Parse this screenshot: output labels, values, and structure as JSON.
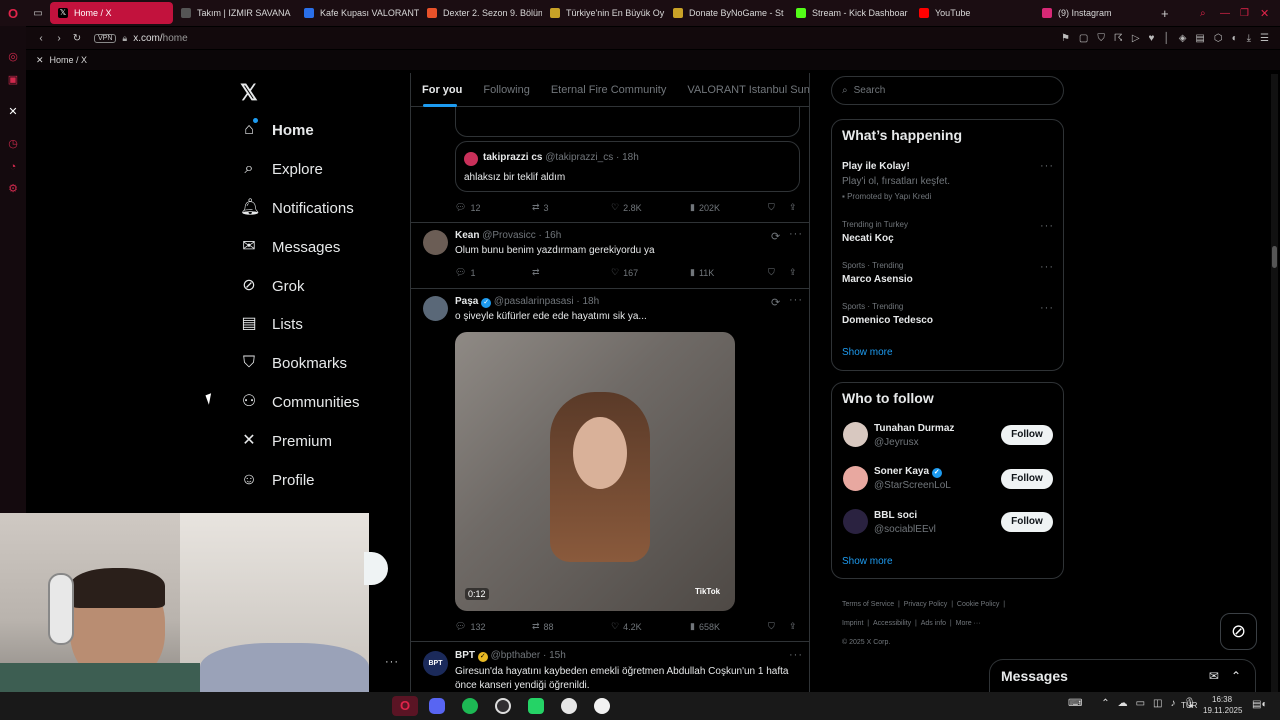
{
  "browser": {
    "tabs": [
      {
        "label": "Home / X",
        "icon": "x-logo",
        "color": "#000000"
      },
      {
        "label": "Takım | IZMIR SAVANA",
        "icon": "group-icon",
        "color": "#444"
      },
      {
        "label": "Kafe Kupası VALORANT",
        "icon": "doc-icon",
        "color": "#2a6fe8"
      },
      {
        "label": "Dexter 2. Sezon 9. Bölüm",
        "icon": "play-icon",
        "color": "#e8522a"
      },
      {
        "label": "Türkiye'nin En Büyük Oy",
        "icon": "game-icon",
        "color": "#c9a227"
      },
      {
        "label": "Donate ByNoGame - St",
        "icon": "game-icon",
        "color": "#c9a227"
      },
      {
        "label": "Stream - Kick Dashboar",
        "icon": "kick-icon",
        "color": "#53fc18"
      },
      {
        "label": "YouTube",
        "icon": "youtube-icon",
        "color": "#ff0000"
      },
      {
        "label": "(9) Instagram",
        "icon": "instagram-icon",
        "color": "#d62976"
      }
    ],
    "vpn": "VPN",
    "url_host": "x.com/",
    "url_path": "home",
    "bookmark": "Home / X"
  },
  "nav": {
    "items": [
      {
        "label": "Home",
        "icon": "home-icon"
      },
      {
        "label": "Explore",
        "icon": "search-icon"
      },
      {
        "label": "Notifications",
        "icon": "bell-icon"
      },
      {
        "label": "Messages",
        "icon": "mail-icon"
      },
      {
        "label": "Grok",
        "icon": "grok-icon"
      },
      {
        "label": "Lists",
        "icon": "list-icon"
      },
      {
        "label": "Bookmarks",
        "icon": "bookmark-icon"
      },
      {
        "label": "Communities",
        "icon": "people-icon"
      },
      {
        "label": "Premium",
        "icon": "x-icon"
      },
      {
        "label": "Profile",
        "icon": "person-icon"
      }
    ]
  },
  "feed": {
    "tabs": [
      "For you",
      "Following",
      "Eternal Fire Community",
      "VALORANT Istanbul Sunucus"
    ],
    "quoted": {
      "name": "takiprazzi cs",
      "handle": "@takiprazzi_cs · 18h",
      "text": "ahlaksız bir teklif aldım"
    },
    "post1_stats": {
      "replies": "12",
      "reposts": "3",
      "likes": "2.8K",
      "views": "202K"
    },
    "post2": {
      "name": "Kean",
      "handle": "@Provasicc · 16h",
      "text": "Olum bunu benim yazdırmam gerekiyordu ya",
      "replies": "1",
      "likes": "167",
      "views": "11K"
    },
    "post3": {
      "name": "Paşa",
      "handle": "@pasalarinpasasi · 18h",
      "text": "o şiveyle küfürler ede ede hayatımı sik ya...",
      "duration": "0:12",
      "watermark": "TikTok",
      "replies": "132",
      "reposts": "88",
      "likes": "4.2K",
      "views": "658K"
    },
    "post4": {
      "name": "BPT",
      "handle": "@bpthaber · 15h",
      "avatar_text": "BPT",
      "text": "Giresun'da hayatını kaybeden emekli öğretmen Abdullah Coşkun'un 1 hafta önce kanseri yendiği öğrenildi."
    }
  },
  "right": {
    "search_placeholder": "Search",
    "happening_title": "What’s happening",
    "promo": {
      "title": "Play ile Kolay!",
      "subtitle": "Play'i ol, fırsatları keşfet.",
      "promoted": "Promoted by Yapı Kredi"
    },
    "trends": [
      {
        "context": "Trending in Turkey",
        "name": "Necati Koç"
      },
      {
        "context": "Sports · Trending",
        "name": "Marco Asensio"
      },
      {
        "context": "Sports · Trending",
        "name": "Domenico Tedesco"
      }
    ],
    "show_more": "Show more",
    "wtf_title": "Who to follow",
    "follow": [
      {
        "name": "Tunahan Durmaz",
        "handle": "@Jeyrusx",
        "button": "Follow"
      },
      {
        "name": "Soner Kaya",
        "handle": "@StarScreenLoL",
        "button": "Follow"
      },
      {
        "name": "BBL soci",
        "handle": "@sociablEEvl",
        "button": "Follow"
      }
    ],
    "show_more2": "Show more",
    "footer": [
      "Terms of Service",
      "Privacy Policy",
      "Cookie Policy",
      "Imprint",
      "Accessibility",
      "Ads info",
      "More ···",
      "© 2025 X Corp."
    ],
    "messages": "Messages"
  },
  "taskbar": {
    "lang": "TUR",
    "time": "16:38",
    "date": "19.11.2025"
  },
  "colors": {
    "accent": "#1d9bf0",
    "browser_red": "#c2123d"
  }
}
